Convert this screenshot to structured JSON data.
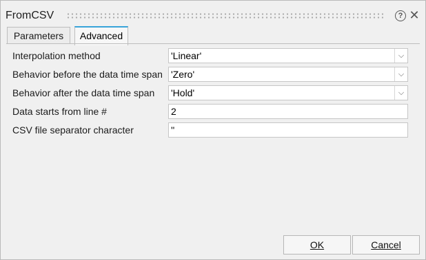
{
  "window": {
    "title": "FromCSV"
  },
  "tabs": [
    {
      "label": "Parameters",
      "selected": false
    },
    {
      "label": "Advanced",
      "selected": true
    }
  ],
  "fields": [
    {
      "label": "Interpolation method",
      "value": "'Linear'",
      "type": "dropdown"
    },
    {
      "label": "Behavior before the data time span",
      "value": "'Zero'",
      "type": "dropdown"
    },
    {
      "label": "Behavior after the data time span",
      "value": "'Hold'",
      "type": "dropdown"
    },
    {
      "label": "Data starts from line #",
      "value": "2",
      "type": "text"
    },
    {
      "label": "CSV file separator character",
      "value": "''",
      "type": "text"
    }
  ],
  "buttons": {
    "ok": "OK",
    "cancel": "Cancel"
  },
  "icons": {
    "help": "help-icon",
    "close": "close-icon",
    "dropdown": "chevron-down-icon"
  },
  "colors": {
    "accent": "#36a3d9",
    "background": "#f0f0f0"
  }
}
